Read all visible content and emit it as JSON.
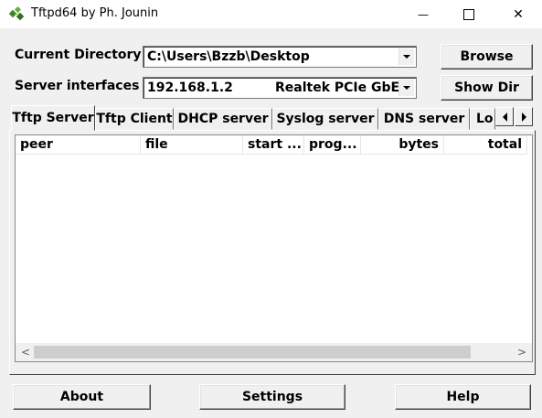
{
  "window": {
    "title": "Tftpd64 by Ph. Jounin",
    "minimize_glyph": "—",
    "close_glyph": "✕"
  },
  "form": {
    "current_directory_label": "Current Directory",
    "current_directory_value": "C:\\Users\\Bzzb\\Desktop",
    "server_interfaces_label": "Server interfaces",
    "server_interface_ip": "192.168.1.2",
    "server_interface_adapter": "Realtek PCIe GbE",
    "browse_label": "Browse",
    "show_dir_label": "Show Dir"
  },
  "tabs": [
    {
      "label": "Tftp Server",
      "active": true
    },
    {
      "label": "Tftp Client",
      "active": false
    },
    {
      "label": "DHCP server",
      "active": false
    },
    {
      "label": "Syslog server",
      "active": false
    },
    {
      "label": "DNS server",
      "active": false
    },
    {
      "label": "Lo",
      "active": false
    }
  ],
  "table": {
    "columns": [
      "peer",
      "file",
      "start ...",
      "prog...",
      "bytes",
      "total"
    ],
    "rows": []
  },
  "scrollbar": {
    "left_glyph": "<",
    "right_glyph": ">"
  },
  "footer": {
    "about_label": "About",
    "settings_label": "Settings",
    "help_label": "Help"
  },
  "icons": {
    "app": "tftpd-app-icon",
    "minimize": "minimize-icon",
    "maximize": "maximize-icon",
    "close": "close-icon"
  },
  "colors": {
    "window_bg": "#f0f0f0",
    "titlebar_bg": "#ffffff",
    "list_bg": "#ffffff",
    "scroll_thumb": "#cdcdcd"
  }
}
